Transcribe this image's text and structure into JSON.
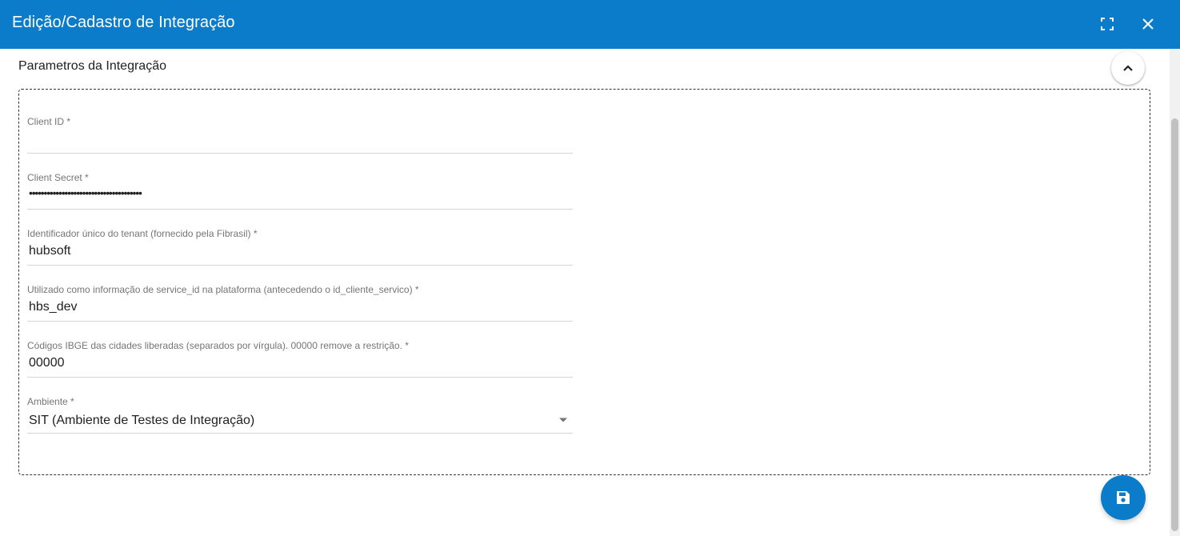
{
  "dialog": {
    "title": "Edição/Cadastro de Integração",
    "icons": {
      "fullscreen": "fullscreen-icon",
      "close": "close-icon"
    }
  },
  "section": {
    "title": "Parametros da Integração",
    "collapse_icon": "chevron-up-icon"
  },
  "fields": {
    "client_id": {
      "label": "Client ID *",
      "value": ""
    },
    "client_secret": {
      "label": "Client Secret *",
      "value": "••••••••••••••••••••••••••••••••••••••"
    },
    "tenant": {
      "label": "Identificador único do tenant (fornecido pela Fibrasil) *",
      "value": "hubsoft"
    },
    "service_id": {
      "label": "Utilizado como informação de service_id na plataforma (antecedendo o id_cliente_servico) *",
      "value": "hbs_dev"
    },
    "ibge": {
      "label": "Códigos IBGE das cidades liberadas (separados por vírgula). 00000 remove a restrição. *",
      "value": "00000"
    },
    "ambiente": {
      "label": "Ambiente *",
      "selected": "SIT (Ambiente de Testes de Integração)"
    }
  },
  "actions": {
    "save_icon": "save-icon"
  },
  "colors": {
    "primary": "#0a7cc9",
    "text": "#212121",
    "label": "#757575"
  }
}
